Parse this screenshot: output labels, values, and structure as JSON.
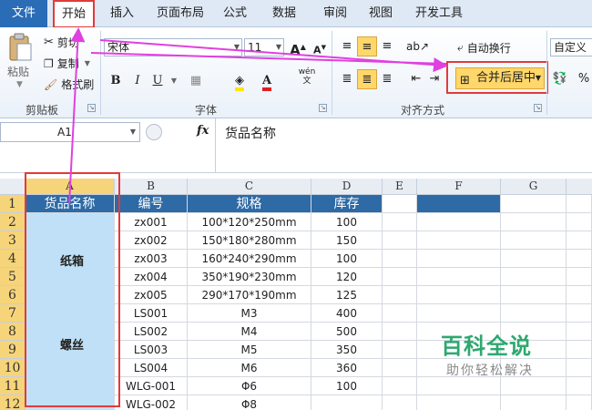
{
  "menu": {
    "file": "文件",
    "tabs": [
      "开始",
      "插入",
      "页面布局",
      "公式",
      "数据",
      "审阅",
      "视图",
      "开发工具"
    ]
  },
  "ribbon": {
    "clipboard": {
      "paste": "粘贴",
      "cut": "剪切",
      "copy": "复制",
      "format_painter": "格式刷",
      "group_label": "剪贴板"
    },
    "font": {
      "name": "宋体",
      "size": "11",
      "bold": "B",
      "italic": "I",
      "underline": "U",
      "phonetic": "wén",
      "grow": "A",
      "shrink": "A",
      "fontcolor": "A",
      "group_label": "字体"
    },
    "alignment": {
      "wrap": "自动换行",
      "merge_center": "合并后居中",
      "group_label": "对齐方式"
    },
    "number": {
      "format": "自定义",
      "percent": "%"
    }
  },
  "formula_bar": {
    "name_box": "A1",
    "fx": "fx",
    "content": "货品名称"
  },
  "grid": {
    "columns": [
      "A",
      "B",
      "C",
      "D",
      "E",
      "F",
      "G"
    ],
    "rows": [
      "1",
      "2",
      "3",
      "4",
      "5",
      "6",
      "7",
      "8",
      "9",
      "10",
      "11",
      "12"
    ],
    "headers": [
      "货品名称",
      "编号",
      "规格",
      "库存"
    ],
    "data": [
      {
        "b": "zx001",
        "c": "100*120*250mm",
        "d": "100"
      },
      {
        "b": "zx002",
        "c": "150*180*280mm",
        "d": "150"
      },
      {
        "b": "zx003",
        "c": "160*240*290mm",
        "d": "100"
      },
      {
        "b": "zx004",
        "c": "350*190*230mm",
        "d": "120"
      },
      {
        "b": "zx005",
        "c": "290*170*190mm",
        "d": "125"
      },
      {
        "b": "LS001",
        "c": "M3",
        "d": "400"
      },
      {
        "b": "LS002",
        "c": "M4",
        "d": "500"
      },
      {
        "b": "LS003",
        "c": "M5",
        "d": "350"
      },
      {
        "b": "LS004",
        "c": "M6",
        "d": "360"
      },
      {
        "b": "WLG-001",
        "c": "Φ6",
        "d": "100"
      },
      {
        "b": "WLG-002",
        "c": "Φ8",
        "d": ""
      }
    ],
    "merged_labels": [
      "纸箱",
      "螺丝"
    ]
  },
  "watermark": {
    "title": "百科全说",
    "subtitle": "助你轻松解决"
  },
  "colors": {
    "header_fill": "#2e6aa5",
    "a_column_fill": "#bfe0f6",
    "highlight_red": "#e23a3a",
    "arrow_magenta": "#e040e0",
    "merge_button": "#ffd76a"
  }
}
